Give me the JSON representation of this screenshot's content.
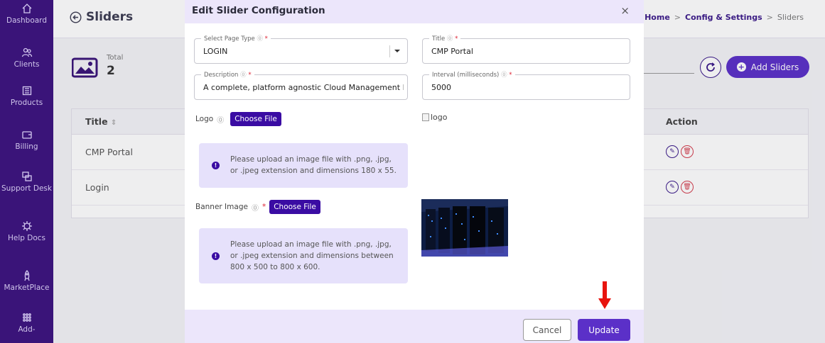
{
  "sidebar": {
    "items": [
      {
        "label": "Dashboard",
        "icon": "home-icon"
      },
      {
        "label": "Clients",
        "icon": "users-icon"
      },
      {
        "label": "Products",
        "icon": "grid-icon"
      },
      {
        "label": "Billing",
        "icon": "wallet-icon"
      },
      {
        "label": "Support Desk",
        "icon": "support-icon"
      },
      {
        "label": "Help Docs",
        "icon": "help-icon"
      },
      {
        "label": "MarketPlace",
        "icon": "rocket-icon"
      },
      {
        "label": "Add-",
        "icon": "apps-icon"
      }
    ]
  },
  "header": {
    "title": "Sliders",
    "breadcrumb": [
      "Home",
      "Config & Settings",
      "Sliders"
    ],
    "breadcrumb_sep": ">"
  },
  "stats": {
    "label": "Total",
    "value": "2"
  },
  "toolbar": {
    "add_label": "Add Sliders"
  },
  "table": {
    "headers": {
      "title": "Title",
      "action": "Action"
    },
    "rows": [
      {
        "title": "CMP Portal"
      },
      {
        "title": "Login"
      }
    ]
  },
  "modal": {
    "title": "Edit Slider Configuration",
    "close": "×",
    "page_type": {
      "label": "Select Page Type",
      "value": "LOGIN"
    },
    "title_field": {
      "label": "Title",
      "value": "CMP Portal"
    },
    "description": {
      "label": "Description",
      "value": "A complete, platform agnostic Cloud Management P"
    },
    "interval": {
      "label": "Interval (milliseconds)",
      "value": "5000"
    },
    "logo": {
      "label": "Logo",
      "button": "Choose File",
      "alt": "logo",
      "info": "Please upload an image file with .png, .jpg, or .jpeg extension and dimensions 180 x 55."
    },
    "banner": {
      "label": "Banner Image",
      "button": "Choose File",
      "info": "Please upload an image file with .png, .jpg, or .jpeg extension and dimensions between 800 x 500 to 800 x 600."
    },
    "cancel_label": "Cancel",
    "update_label": "Update"
  },
  "colors": {
    "primary": "#5b30c8",
    "sidebar": "#3a1479",
    "arrow": "#e8140e"
  }
}
